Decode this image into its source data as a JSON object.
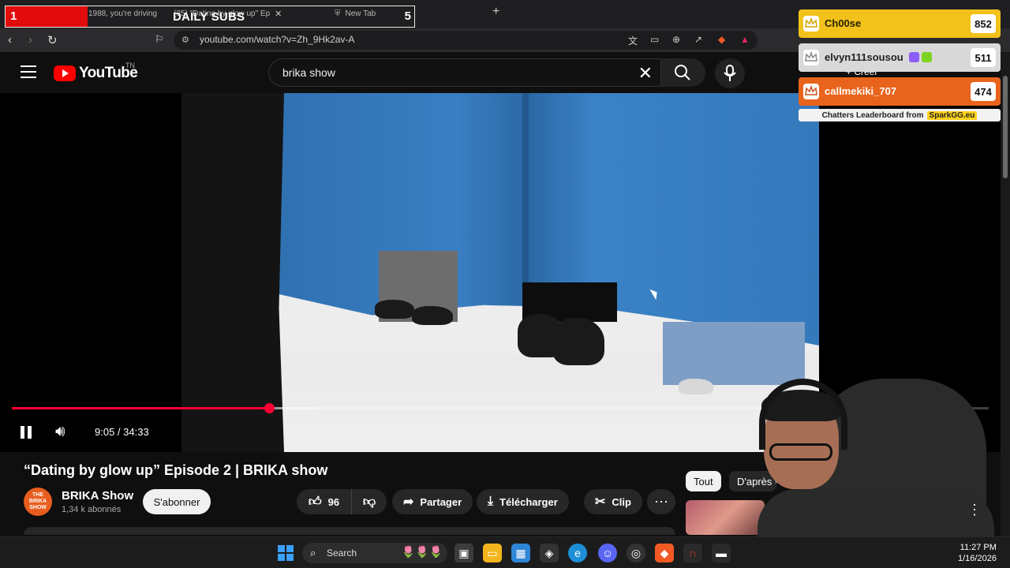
{
  "browser": {
    "tabs": [
      {
        "label": "1988, you're driving"
      },
      {
        "label": "(35) \"Dating by glow up\" Ep"
      },
      {
        "label": "New Tab"
      }
    ],
    "url": "youtube.com/watch?v=Zh_9Hk2av-A"
  },
  "sub_counter": {
    "start": "1",
    "title": "DAILY SUBS",
    "goal": "5"
  },
  "youtube": {
    "logo_text": "YouTube",
    "country_code": "TN",
    "search_value": "brika show",
    "create_label": "Créer"
  },
  "player": {
    "current_time": "9:05",
    "duration": "34:33",
    "time_display": "9:05 / 34:33",
    "progress_fraction": 0.263,
    "buffered_fraction": 0.31
  },
  "video": {
    "title": "“Dating by glow up” Episode 2 | BRIKA show",
    "channel_name": "BRIKA Show",
    "channel_avatar_text": "THE BRIKA SHOW",
    "subscribers": "1,34 k abonnés",
    "subscribe_label": "S'abonner",
    "like_count": "96",
    "share_label": "Partager",
    "download_label": "Télécharger",
    "clip_label": "Clip"
  },
  "related_chips": {
    "all": "Tout",
    "after": "D'après vos"
  },
  "leaderboard": {
    "rows": [
      {
        "name": "Ch00se",
        "score": "852",
        "color": "#f2c21b"
      },
      {
        "name": "elvyn111sousou",
        "score": "511",
        "color": "#d9d9d9"
      },
      {
        "name": "callmekiki_707",
        "score": "474",
        "color": "#e8641c"
      }
    ],
    "footer_text": "Chatters Leaderboard from",
    "footer_brand": "SparkGG.eu"
  },
  "taskbar": {
    "search_label": "Search",
    "time": "11:27 PM",
    "date": "1/16/2026"
  },
  "colors": {
    "youtube_red": "#ff0000",
    "progress_red": "#ff0033",
    "accent_blue": "#3aa0ff"
  }
}
